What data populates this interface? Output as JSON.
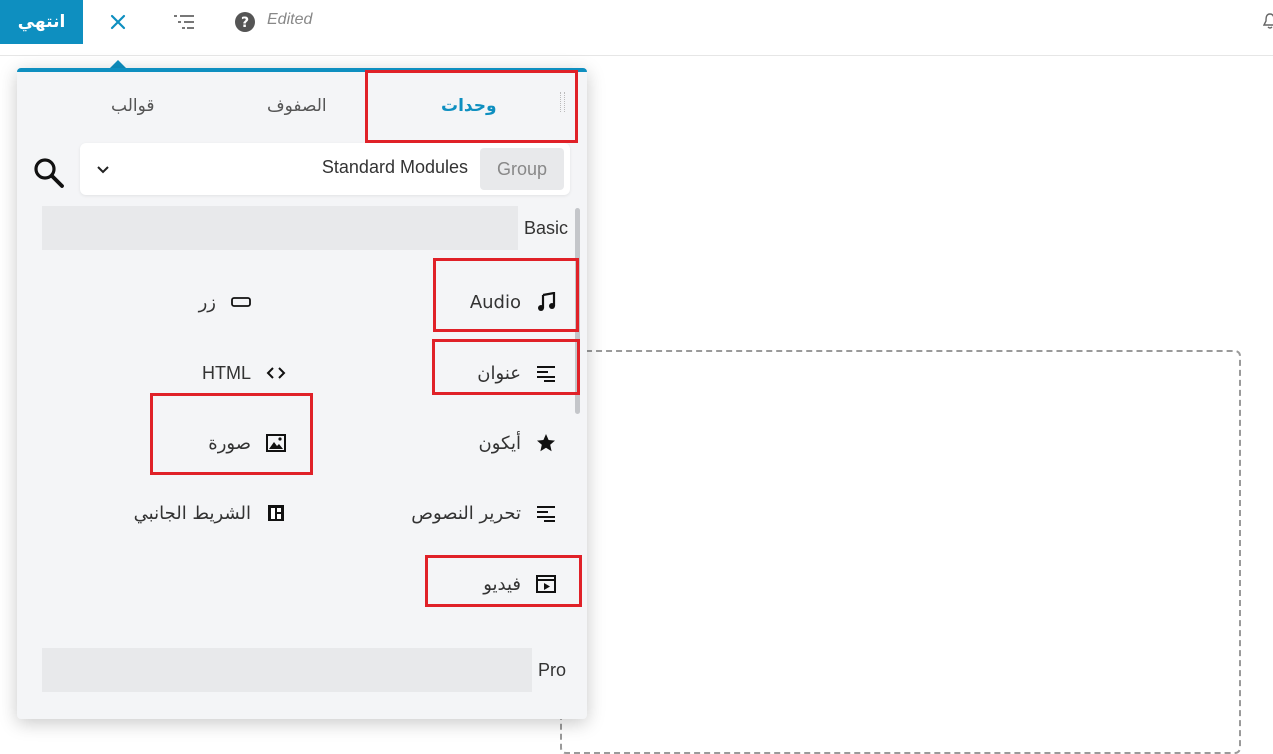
{
  "topbar": {
    "done_label": "انتهي",
    "status_text": "Edited",
    "icons": [
      "close-icon",
      "outline-list-icon",
      "help-icon",
      "bell-icon"
    ]
  },
  "panel": {
    "tabs": [
      {
        "label": "وحدات",
        "active": true
      },
      {
        "label": "الصفوف",
        "active": false
      },
      {
        "label": "قوالب",
        "active": false
      }
    ],
    "group": {
      "label": "Group",
      "selected": "Standard Modules"
    },
    "sections": [
      {
        "label": "Basic",
        "modules": [
          {
            "label": "Audio",
            "icon": "music-note-icon"
          },
          {
            "label": "زر",
            "icon": "button-icon"
          },
          {
            "label": "عنوان",
            "icon": "heading-icon"
          },
          {
            "label": "HTML",
            "icon": "code-icon"
          },
          {
            "label": "أيكون",
            "icon": "star-icon"
          },
          {
            "label": "صورة",
            "icon": "image-icon"
          },
          {
            "label": "تحرير النصوص",
            "icon": "text-editor-icon"
          },
          {
            "label": "الشريط الجانبي",
            "icon": "sidebar-icon"
          },
          {
            "label": "فيديو",
            "icon": "video-icon"
          }
        ]
      },
      {
        "label": "Pro",
        "modules": []
      }
    ]
  },
  "colors": {
    "accent": "#0e8fc0",
    "highlight": "#e02128",
    "panel_bg": "#f4f5f7"
  }
}
